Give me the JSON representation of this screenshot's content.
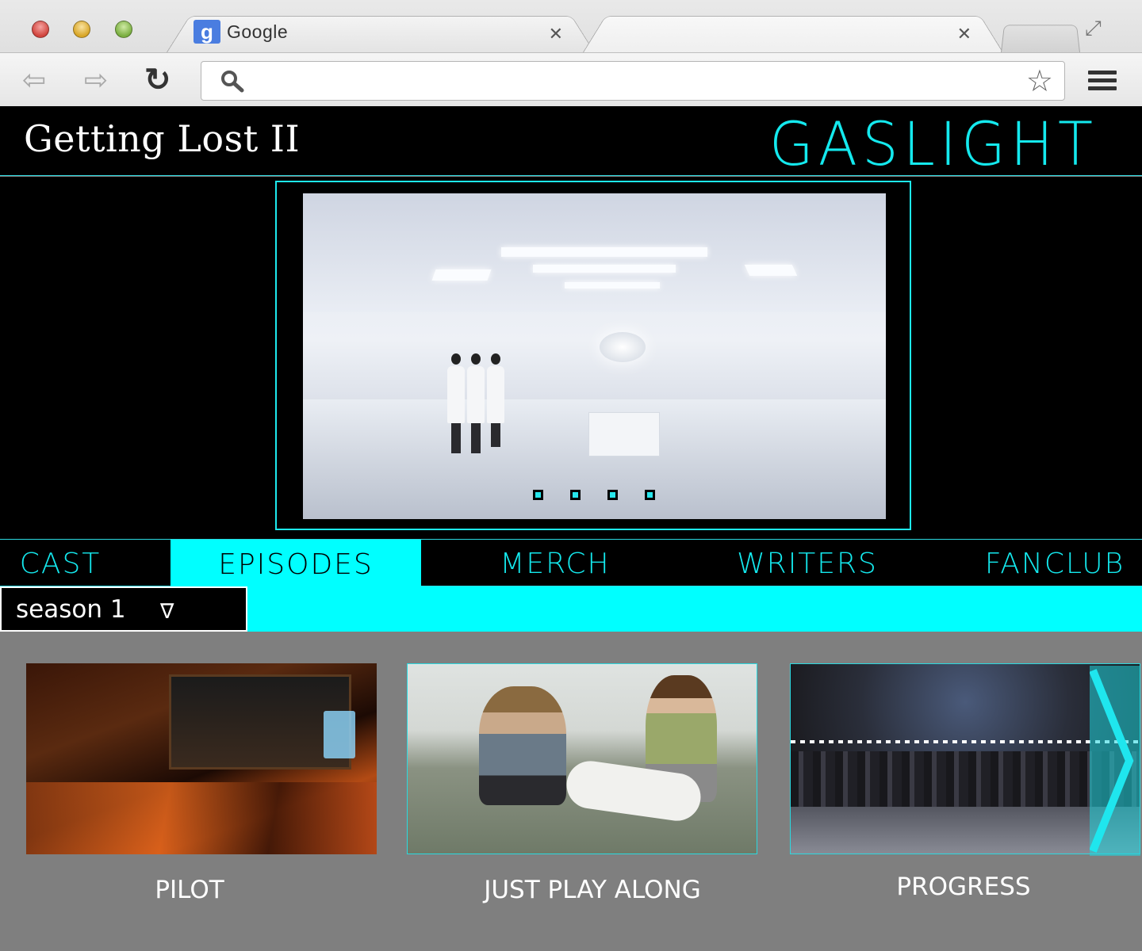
{
  "browser": {
    "tabs": [
      {
        "title": "Google",
        "icon": "google-g-icon",
        "close": "✕"
      },
      {
        "title": "",
        "close": "✕"
      }
    ],
    "logo_letter": "g",
    "address": ""
  },
  "site": {
    "title": "Getting Lost II",
    "brand": "GASLIGHT"
  },
  "hero": {
    "slide_count": 4
  },
  "nav": {
    "items": [
      {
        "label": "CAST"
      },
      {
        "label": "EPISODES",
        "active": true
      },
      {
        "label": "MERCH"
      },
      {
        "label": "WRITERS"
      },
      {
        "label": "FANCLUB"
      }
    ]
  },
  "season_select": {
    "value": "season 1",
    "arrow": "∇"
  },
  "episodes": [
    {
      "title": "PILOT"
    },
    {
      "title": "JUST PLAY ALONG"
    },
    {
      "title": "PROGRESS"
    }
  ],
  "colors": {
    "accent": "#00ffff",
    "header_bg": "#000000",
    "content_bg": "#7f7f7f"
  }
}
